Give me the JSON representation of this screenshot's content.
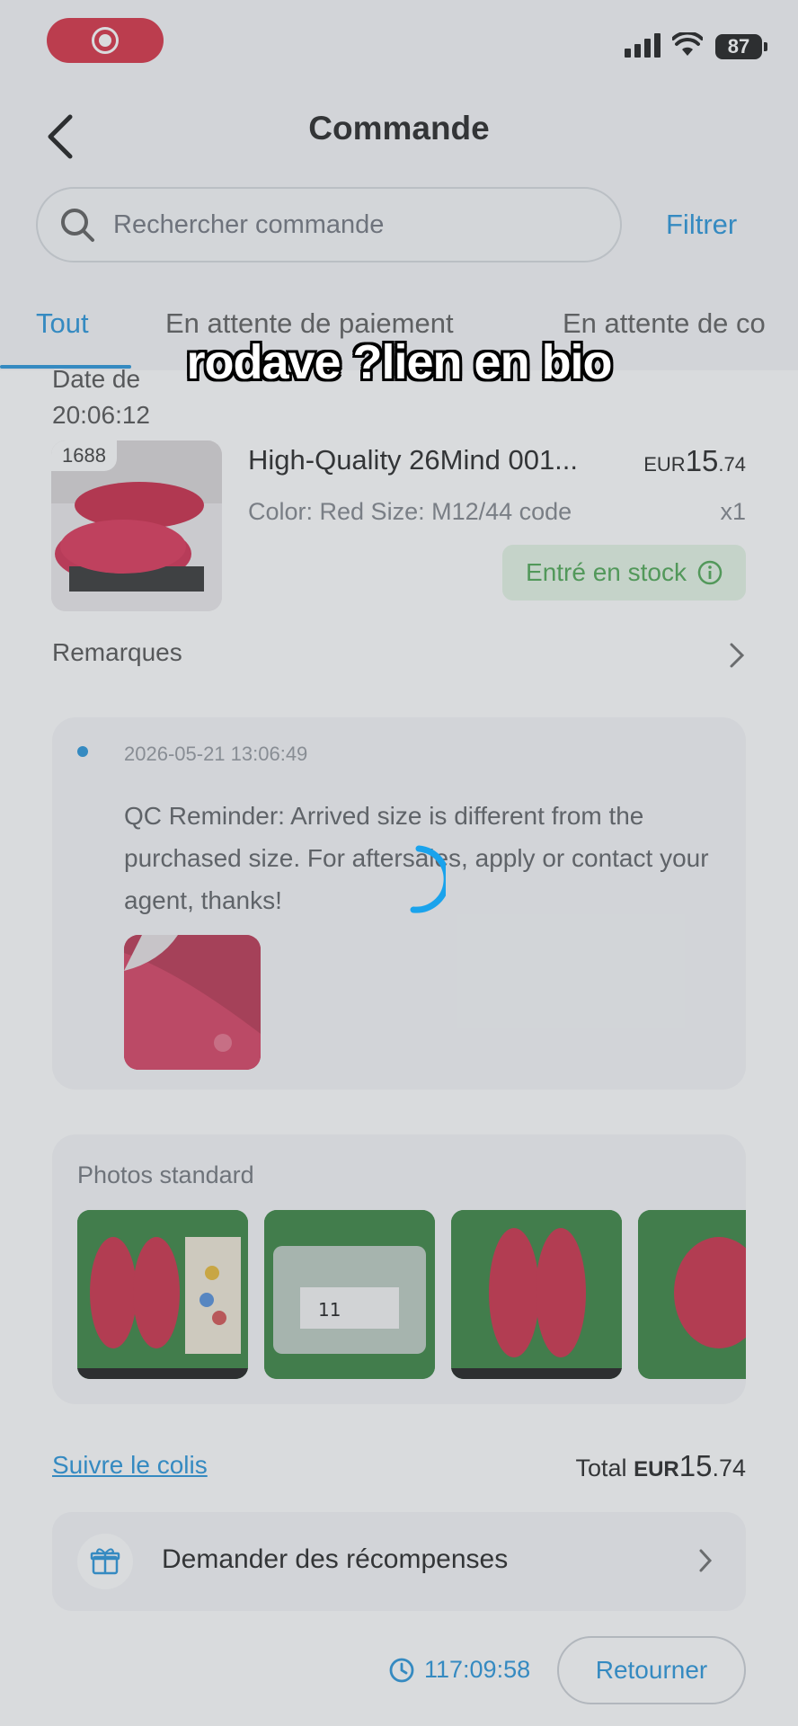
{
  "status_bar": {
    "battery": "87"
  },
  "header": {
    "title": "Commande"
  },
  "search": {
    "placeholder": "Rechercher commande",
    "filter_label": "Filtrer"
  },
  "tabs": [
    {
      "label": "Tout",
      "active": true
    },
    {
      "label": "En attente de paiement",
      "active": false
    },
    {
      "label": "En attente de co",
      "active": false
    }
  ],
  "overlay": {
    "caption": "rodave ?lien en bio"
  },
  "order": {
    "date_label": "Date de",
    "date_time": "20:06:12",
    "product": {
      "badge": "1688",
      "name": "High-Quality 26Mind 001...",
      "price_currency": "EUR",
      "price_int": "15",
      "price_dec": ".74",
      "variant": "Color: Red Size: M12/44 code",
      "qty": "x1",
      "status": "Entré en stock"
    },
    "remarks_label": "Remarques",
    "qc": {
      "timestamp": "2026-05-21 13:06:49",
      "message": "QC Reminder: Arrived size is different from the purchased size. For aftersales, apply or contact your agent, thanks!"
    },
    "photos": {
      "title": "Photos standard",
      "count_visible": 4
    },
    "track_label": "Suivre le colis",
    "total": {
      "label": "Total",
      "currency": "EUR",
      "int": "15",
      "dec": ".74"
    },
    "rewards_label": "Demander des récompenses",
    "timer": "117:09:58",
    "return_label": "Retourner"
  },
  "colors": {
    "accent": "#1c8fd8",
    "stock_green": "#44a24a",
    "record_red": "#d6243a"
  }
}
